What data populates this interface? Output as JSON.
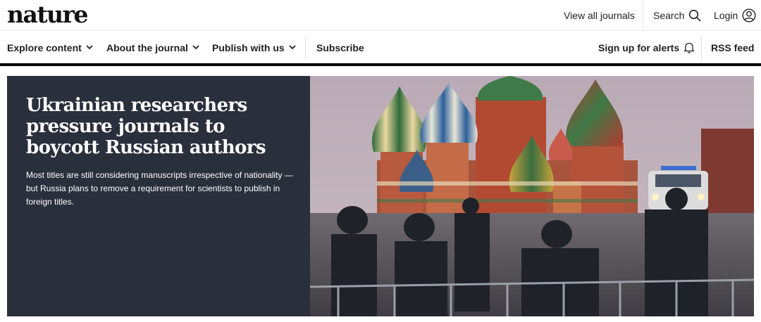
{
  "header": {
    "logo": "nature",
    "view_all_journals": "View all journals",
    "search_label": "Search",
    "login_label": "Login",
    "icons": {
      "search": "search-icon",
      "login": "user-circle-icon"
    }
  },
  "nav": {
    "explore": "Explore content",
    "about": "About the journal",
    "publish": "Publish with us",
    "subscribe": "Subscribe",
    "alerts": "Sign up for alerts",
    "rss": "RSS feed",
    "icons": {
      "dropdown": "chevron-down-icon",
      "alerts": "bell-icon"
    }
  },
  "hero": {
    "title": "Ukrainian researchers pressure journals to boycott Russian authors",
    "summary": "Most titles are still considering manuscripts irrespective of nationality — but Russia plans to remove a requirement for scientists to publish in foreign titles.",
    "image_alt": "photo-st-basils-cathedral-red-square-police"
  },
  "colors": {
    "hero_panel": "#29303b",
    "rule": "#000000",
    "text": "#222222"
  }
}
